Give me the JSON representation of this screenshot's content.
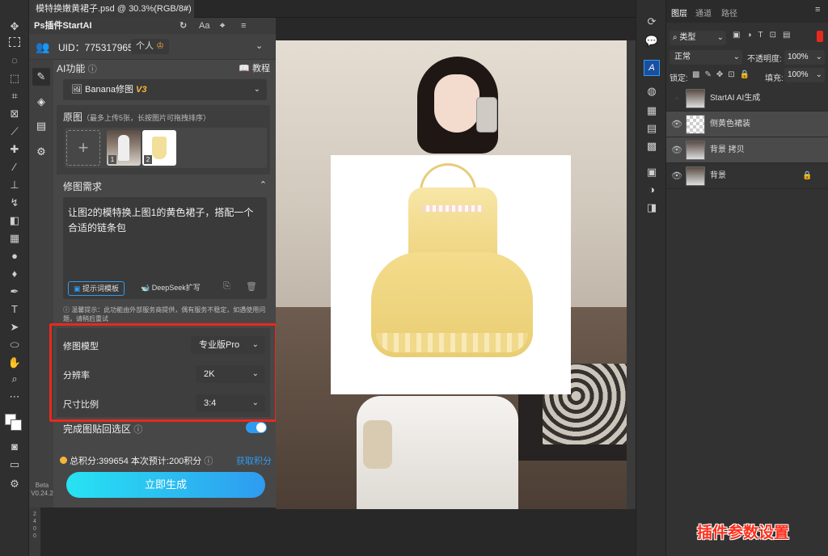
{
  "document": {
    "tab_title": "模特换嫩黄裙子.psd @ 30.3%(RGB/8#) *",
    "close_glyph": "×"
  },
  "plugin": {
    "title": "Ps插件StartAI",
    "uid": "UID：775317965",
    "account_type": "个人",
    "ai_function_label": "AI功能",
    "tutorial_label": "教程",
    "function_value": "Banana修图",
    "function_version": "V3",
    "source_label": "原图",
    "source_hint": "（最多上传5张，长按图片可拖拽排序）",
    "thumb1_index": "1",
    "thumb2_index": "2",
    "requirement_label": "修图需求",
    "prompt_text": "让图2的模特换上图1的黄色裙子，搭配一个合适的链条包",
    "template_btn": "提示词模板",
    "deepseek_btn": "DeepSeek扩写",
    "tip_text": "温馨提示：此功能由外部服务商提供，偶有服务不稳定，如遇使用问题，请稍后重试",
    "model_label": "修图模型",
    "model_value": "专业版Pro",
    "resolution_label": "分辨率",
    "resolution_value": "2K",
    "ratio_label": "尺寸比例",
    "ratio_value": "3:4",
    "paste_label": "完成图贴回选区",
    "paste_toggle": true,
    "points_total": "总积分:399654",
    "points_estimate": "本次预计:200积分",
    "get_points": "获取积分",
    "generate_btn": "立即生成",
    "beta_label": "Beta",
    "version": "V0.24.2"
  },
  "ruler": {
    "v1": "2",
    "v2": "4",
    "v3": "0",
    "v4": "0"
  },
  "layers_panel": {
    "tabs": [
      "图层",
      "通道",
      "路径"
    ],
    "filter_label": "类型",
    "blend_mode": "正常",
    "opacity_label": "不透明度:",
    "opacity_value": "100%",
    "lock_label": "锁定:",
    "fill_label": "填充:",
    "fill_value": "100%",
    "layers": [
      {
        "name": "StartAI AI生成",
        "visible": false
      },
      {
        "name": "侧黄色裙装",
        "visible": true
      },
      {
        "name": "背景 拷贝",
        "visible": true
      },
      {
        "name": "背景",
        "visible": true,
        "locked": true
      }
    ]
  },
  "caption": "插件参数设置",
  "colors": {
    "highlight": "#e8291c",
    "gradient_start": "#27e3f2",
    "gradient_end": "#2f9bf0",
    "accent_blue": "#2f9bf0"
  }
}
